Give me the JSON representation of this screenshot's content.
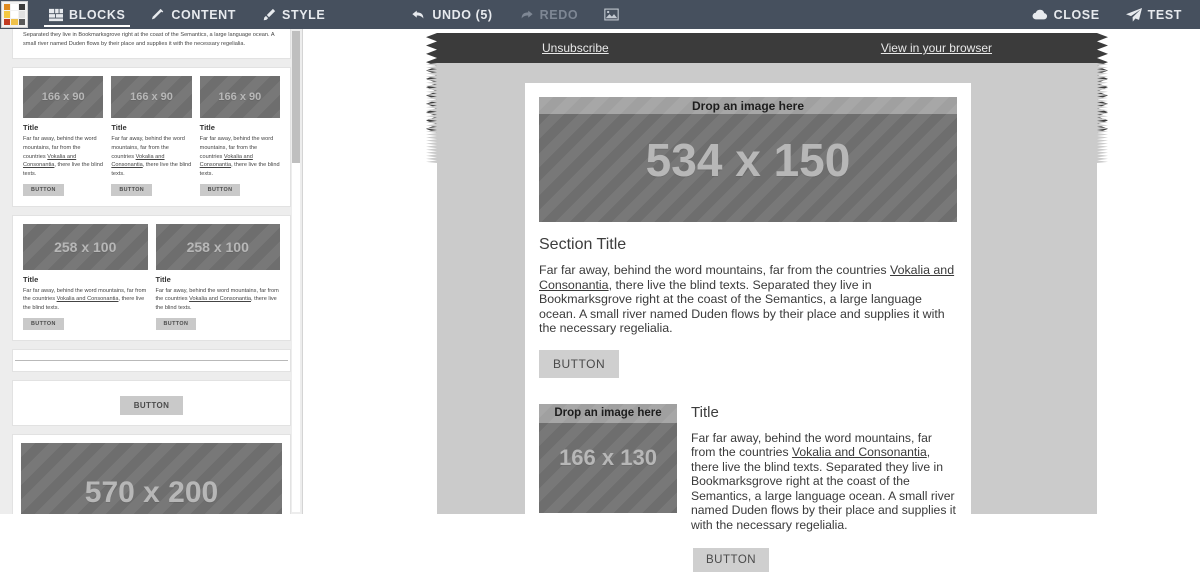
{
  "toolbar": {
    "logo_name": "app-logo",
    "logo_colors": [
      "#e08a1e",
      "#ffffff",
      "#3c3c3c",
      "#f4c842",
      "#ffffff",
      "#e0e0e0",
      "#c23b22",
      "#efc14a",
      "#5a5a5a"
    ],
    "tabs": [
      {
        "label": "BLOCKS",
        "icon": "blocks-icon",
        "active": true
      },
      {
        "label": "CONTENT",
        "icon": "pencil-icon",
        "active": false
      },
      {
        "label": "STYLE",
        "icon": "brush-icon",
        "active": false
      }
    ],
    "history": [
      {
        "label": "UNDO (5)",
        "icon": "undo-arrow-icon",
        "disabled": false
      },
      {
        "label": "REDO",
        "icon": "redo-arrow-icon",
        "disabled": true
      }
    ],
    "image_button": {
      "icon": "image-icon",
      "label": ""
    },
    "actions": [
      {
        "label": "CLOSE",
        "icon": "cloud-icon"
      },
      {
        "label": "TEST",
        "icon": "paper-plane-icon"
      }
    ],
    "bar_color": "#46505e"
  },
  "sidebar": {
    "scrollbar": {
      "visible": true
    },
    "blocks": [
      {
        "type": "text-block",
        "text": "Separated they live in Bookmarksgrove right at the coast of the Semantics, a large language ocean. A small river named Duden flows by their place and supplies it with the necessary regelialia."
      },
      {
        "type": "three-column-block",
        "columns": [
          {
            "placeholder": "166 x 90",
            "title": "Title",
            "text_pre": "Far far away, behind the word mountains, far from the countries ",
            "link": "Vokalia and Consonantia",
            "text_post": ", there live the blind texts.",
            "button": "BUTTON"
          },
          {
            "placeholder": "166 x 90",
            "title": "Title",
            "text_pre": "Far far away, behind the word mountains, far from the countries ",
            "link": "Vokalia and Consonantia",
            "text_post": ", there live the blind texts.",
            "button": "BUTTON"
          },
          {
            "placeholder": "166 x 90",
            "title": "Title",
            "text_pre": "Far far away, behind the word mountains, far from the countries ",
            "link": "Vokalia and Consonantia",
            "text_post": ", there live the blind texts.",
            "button": "BUTTON"
          }
        ]
      },
      {
        "type": "two-column-block",
        "columns": [
          {
            "placeholder": "258 x 100",
            "title": "Title",
            "text_pre": "Far far away, behind the word mountains, far from the countries ",
            "link": "Vokalia and Consonantia",
            "text_post": ", there live the blind texts.",
            "button": "BUTTON"
          },
          {
            "placeholder": "258 x 100",
            "title": "Title",
            "text_pre": "Far far away, behind the word mountains, far from the countries ",
            "link": "Vokalia and Consonantia",
            "text_post": ", there live the blind texts.",
            "button": "BUTTON"
          }
        ]
      },
      {
        "type": "divider-block"
      },
      {
        "type": "button-block",
        "button": "BUTTON"
      },
      {
        "type": "image-block",
        "placeholder": "570 x 200"
      }
    ]
  },
  "canvas": {
    "header": {
      "unsubscribe": "Unsubscribe",
      "view_in_browser": "View in your browser",
      "background": "#3b3b3b"
    },
    "hero": {
      "drop_hint": "Drop an image here",
      "placeholder": "534 x 150"
    },
    "section": {
      "title": "Section Title",
      "text_pre": "Far far away, behind the word mountains, far from the countries ",
      "link": "Vokalia and Consonantia",
      "text_post": ", there live the blind texts. Separated they live in Bookmarksgrove right at the coast of the Semantics, a large language ocean. A small river named Duden flows by their place and supplies it with the necessary regelialia.",
      "button": "BUTTON"
    },
    "media_section": {
      "drop_hint": "Drop an image here",
      "placeholder": "166 x 130",
      "title": "Title",
      "text_pre": "Far far away, behind the word mountains, far from the countries ",
      "link": "Vokalia and Consonantia",
      "text_post": ", there live the blind texts. Separated they live in Bookmarksgrove right at the coast of the Semantics, a large language ocean. A small river named Duden flows by their place and supplies it with the necessary regelialia.",
      "button": "BUTTON"
    },
    "page_background": "#cbcbcb",
    "sheet_background": "#ffffff"
  }
}
